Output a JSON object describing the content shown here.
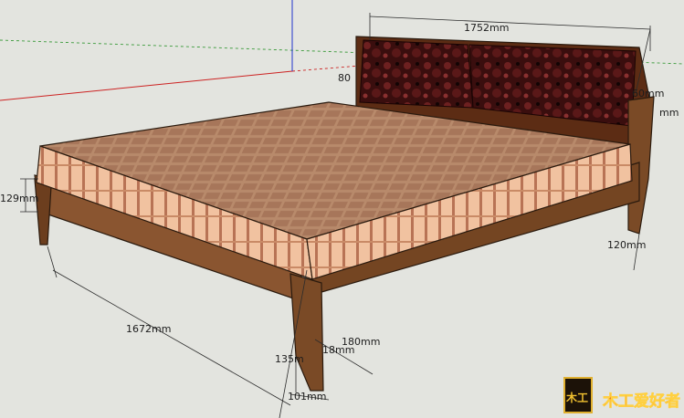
{
  "dimensions": {
    "bed_width": "1752mm",
    "headboard_height_partial": "80",
    "headboard_top_right": "60mm",
    "headboard_side_right": "mm",
    "rail_height": "129mm",
    "bed_length": "1672mm",
    "foot_right": "120mm",
    "leg_height": "180mm",
    "leg_small": "18mm",
    "leg_offset": "135m",
    "leg_width": "101mm"
  },
  "logo": {
    "text": "木工爱好者",
    "mark_text": "木工"
  },
  "colors": {
    "background": "#e3e4df",
    "wood": "#7a4a26",
    "wood_dark": "#4e2e16",
    "mattress_top": "#b98a6c",
    "mattress_side": "#e9b28e",
    "headboard": "#3b1010",
    "axis_red": "#cc2222",
    "axis_green": "#3a9a3a",
    "axis_blue": "#2233cc"
  }
}
